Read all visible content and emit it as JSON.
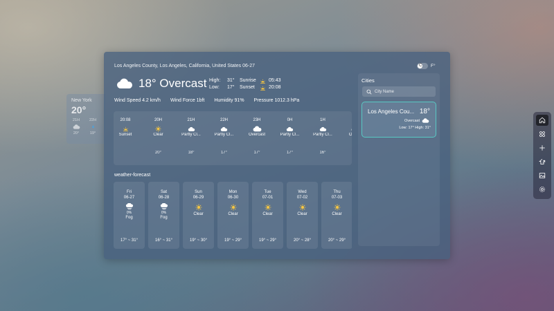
{
  "mini_card": {
    "city": "New York",
    "temp": "20°",
    "hours": [
      {
        "time": "21H",
        "icon": "cloud-icon",
        "temp": "20°"
      },
      {
        "time": "22H",
        "icon": "rain-icon",
        "temp": "19°"
      }
    ]
  },
  "header": {
    "location": "Los Angeles County, Los Angeles, California, United States  06-27",
    "unit_c": "C",
    "unit_f": "F°"
  },
  "current": {
    "temp_condition": "18° Overcast",
    "high_label": "High:",
    "high": "31°",
    "low_label": "Low:",
    "low": "17°",
    "sunrise_label": "Sunrise",
    "sunrise": "05:43",
    "sunset_label": "Sunset",
    "sunset": "20:08"
  },
  "stats": {
    "wind_speed": "Wind Speed 4.2 km/h",
    "wind_force": "Wind Force 1bft",
    "humidity": "Humidity 91%",
    "pressure": "Pressure 1012.3 hPa"
  },
  "hourly": [
    {
      "time": "20:08",
      "icon": "sunset-icon",
      "cond": "Sunset",
      "temp": ""
    },
    {
      "time": "20H",
      "icon": "sun-icon",
      "cond": "Clear",
      "temp": "20°"
    },
    {
      "time": "21H",
      "icon": "partly-cloudy-icon",
      "cond": "Partly Cl...",
      "temp": "18°"
    },
    {
      "time": "22H",
      "icon": "partly-cloudy-icon",
      "cond": "Partly Cl...",
      "temp": "17°"
    },
    {
      "time": "23H",
      "icon": "cloud-icon",
      "cond": "Overcast",
      "temp": "17°"
    },
    {
      "time": "0H",
      "icon": "partly-cloudy-icon",
      "cond": "Partly Cl...",
      "temp": "17°"
    },
    {
      "time": "1H",
      "icon": "partly-cloudy-icon",
      "cond": "Partly Cl...",
      "temp": "16°"
    },
    {
      "time": "2H",
      "icon": "cloud-icon",
      "cond": "Overca",
      "temp": "16°"
    }
  ],
  "forecast_title": "weather-forecast",
  "daily": [
    {
      "day": "Fri",
      "date": "06-27",
      "icon": "fog-icon",
      "pop": "0%",
      "cond": "Fog",
      "range": "17° ~ 31°"
    },
    {
      "day": "Sat",
      "date": "06-28",
      "icon": "fog-icon",
      "pop": "0%",
      "cond": "Fog",
      "range": "16° ~ 31°"
    },
    {
      "day": "Sun",
      "date": "06-29",
      "icon": "sun-icon",
      "pop": "",
      "cond": "Clear",
      "range": "19° ~ 30°"
    },
    {
      "day": "Mon",
      "date": "06-30",
      "icon": "sun-icon",
      "pop": "",
      "cond": "Clear",
      "range": "19° ~ 29°"
    },
    {
      "day": "Tue",
      "date": "07-01",
      "icon": "sun-icon",
      "pop": "",
      "cond": "Clear",
      "range": "19° ~ 29°"
    },
    {
      "day": "Wed",
      "date": "07-02",
      "icon": "sun-icon",
      "pop": "",
      "cond": "Clear",
      "range": "20° ~ 28°"
    },
    {
      "day": "Thu",
      "date": "07-03",
      "icon": "sun-icon",
      "pop": "",
      "cond": "Clear",
      "range": "20° ~ 29°"
    }
  ],
  "cities": {
    "title": "Cities",
    "search_placeholder": "City Name",
    "card": {
      "name": "Los Angeles Cou...",
      "temp": "18°",
      "cond": "Overcast",
      "low_high": "Low: 17°   High: 31°"
    }
  },
  "dock": [
    {
      "name": "home-icon",
      "active": true
    },
    {
      "name": "apps-icon",
      "active": false
    },
    {
      "name": "add-icon",
      "active": false
    },
    {
      "name": "share-icon",
      "active": false
    },
    {
      "name": "image-icon",
      "active": false
    },
    {
      "name": "settings-icon",
      "active": false
    }
  ],
  "colors": {
    "accent_border": "#58c9c4",
    "sun": "#f5c542",
    "rain": "#4aa3e0"
  }
}
